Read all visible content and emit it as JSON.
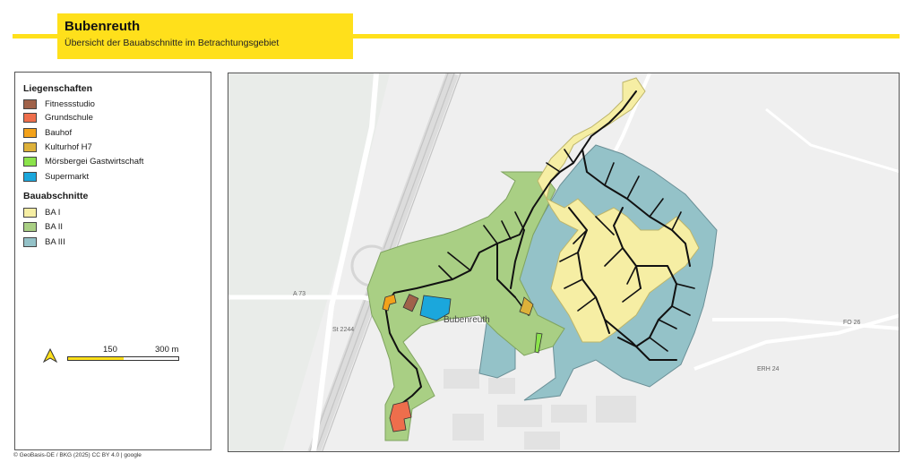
{
  "header": {
    "title": "Bubenreuth",
    "subtitle": "Übersicht der Bauabschnitte im Betrachtungsgebiet"
  },
  "legend": {
    "properties_heading": "Liegenschaften",
    "properties": [
      {
        "label": "Fitnessstudio",
        "color": "#a0624a"
      },
      {
        "label": "Grundschule",
        "color": "#ee6e4c"
      },
      {
        "label": "Bauhof",
        "color": "#f3a21b"
      },
      {
        "label": "Kulturhof H7",
        "color": "#ddb13a"
      },
      {
        "label": "Mörsbergei Gastwirtschaft",
        "color": "#8be34b"
      },
      {
        "label": "Supermarkt",
        "color": "#1ba7dc"
      }
    ],
    "phases_heading": "Bauabschnitte",
    "phases": [
      {
        "label": "BA I",
        "color": "#f6eea4"
      },
      {
        "label": "BA II",
        "color": "#a9cf84"
      },
      {
        "label": "BA III",
        "color": "#94c2c8"
      }
    ]
  },
  "scale": {
    "mid_label": "150",
    "end_label": "300 m"
  },
  "map_labels": {
    "town": "Bubenreuth",
    "road_a73": "A 73",
    "road_st2244": "St 2244",
    "road_fo26": "FO 26",
    "road_erh24": "ERH 24"
  },
  "credits": "© GeoBasis-DE / BKG (2025) CC BY 4.0 | google",
  "colors": {
    "accent": "#ffe01b",
    "pipe": "#111111"
  }
}
